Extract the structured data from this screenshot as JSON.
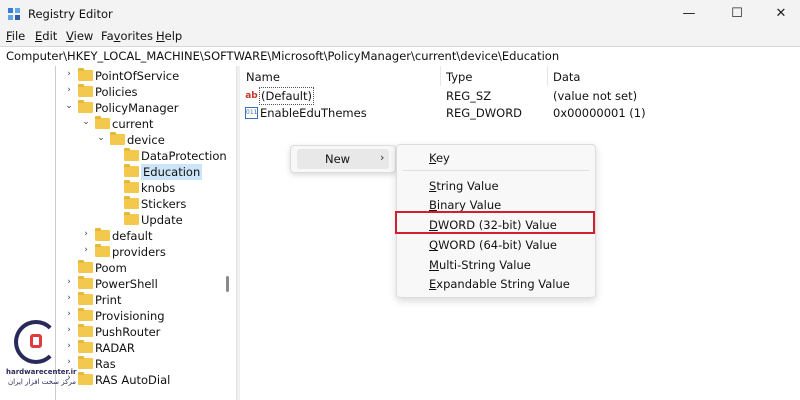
{
  "window": {
    "title": "Registry Editor",
    "minimize_glyph": "—",
    "maximize_glyph": "☐",
    "close_glyph": "✕"
  },
  "menubar": {
    "items": [
      {
        "mnemonic": "F",
        "rest": "ile"
      },
      {
        "mnemonic": "E",
        "rest": "dit"
      },
      {
        "mnemonic": "V",
        "rest": "iew"
      },
      {
        "mnemonic": "",
        "first": "F",
        "first_rest": "a",
        "mnemonic2": "v",
        "rest": "orites"
      },
      {
        "mnemonic": "H",
        "rest": "elp"
      }
    ],
    "favorites_label": "Favorites"
  },
  "address": "Computer\\HKEY_LOCAL_MACHINE\\SOFTWARE\\Microsoft\\PolicyManager\\current\\device\\Education",
  "tree": {
    "items": [
      {
        "label": "PointOfService",
        "expander": "›"
      },
      {
        "label": "Policies",
        "expander": "›"
      },
      {
        "label": "PolicyManager",
        "expander": "⌄"
      },
      {
        "label": "current",
        "expander": "⌄"
      },
      {
        "label": "device",
        "expander": "⌄"
      },
      {
        "label": "DataProtection",
        "expander": ""
      },
      {
        "label": "Education",
        "expander": ""
      },
      {
        "label": "knobs",
        "expander": ""
      },
      {
        "label": "Stickers",
        "expander": ""
      },
      {
        "label": "Update",
        "expander": ""
      },
      {
        "label": "default",
        "expander": "›"
      },
      {
        "label": "providers",
        "expander": "›"
      },
      {
        "label": "Poom",
        "expander": ""
      },
      {
        "label": "PowerShell",
        "expander": "›"
      },
      {
        "label": "Print",
        "expander": "›"
      },
      {
        "label": "Provisioning",
        "expander": "›"
      },
      {
        "label": "PushRouter",
        "expander": "›"
      },
      {
        "label": "RADAR",
        "expander": "›"
      },
      {
        "label": "Ras",
        "expander": "›"
      },
      {
        "label": "RAS AutoDial",
        "expander": "›"
      }
    ]
  },
  "list": {
    "columns": {
      "name": "Name",
      "type": "Type",
      "data": "Data"
    },
    "rows": [
      {
        "icon": "ab",
        "name": "(Default)",
        "type": "REG_SZ",
        "data": "(value not set)"
      },
      {
        "icon": "011",
        "name": "EnableEduThemes",
        "type": "REG_DWORD",
        "data": "0x00000001 (1)"
      }
    ]
  },
  "context_menu": {
    "new_label": "New",
    "arrow": "›"
  },
  "submenu": {
    "items": [
      {
        "u": "K",
        "rest": "ey"
      },
      {
        "u": "S",
        "rest": "tring Value"
      },
      {
        "u": "B",
        "rest": "inary Value"
      },
      {
        "u": "D",
        "rest": "WORD (32-bit) Value"
      },
      {
        "u": "Q",
        "rest": "WORD (64-bit) Value"
      },
      {
        "u": "M",
        "rest": "ulti-String Value"
      },
      {
        "u": "E",
        "rest": "xpandable String Value"
      }
    ]
  },
  "watermark": {
    "line1": "hardwarecenter.ir",
    "line2": "مرکز سخت افزار ایران"
  },
  "colors": {
    "highlight_border": "#d0202f",
    "folder": "#f2c94c",
    "selection": "#cce4f7"
  }
}
